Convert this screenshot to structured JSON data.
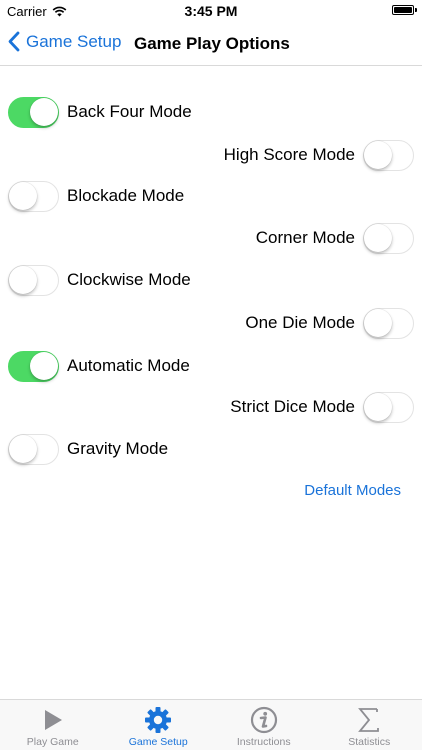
{
  "status": {
    "carrier": "Carrier",
    "time": "3:45 PM"
  },
  "nav": {
    "back_label": "Game Setup",
    "title": "Game Play Options"
  },
  "options": [
    {
      "label": "Back Four Mode",
      "on": true,
      "side": "left"
    },
    {
      "label": "High Score Mode",
      "on": false,
      "side": "right"
    },
    {
      "label": "Blockade Mode",
      "on": false,
      "side": "left"
    },
    {
      "label": "Corner Mode",
      "on": false,
      "side": "right"
    },
    {
      "label": "Clockwise Mode",
      "on": false,
      "side": "left"
    },
    {
      "label": "One Die Mode",
      "on": false,
      "side": "right"
    },
    {
      "label": "Automatic Mode",
      "on": true,
      "side": "left"
    },
    {
      "label": "Strict Dice Mode",
      "on": false,
      "side": "right"
    },
    {
      "label": "Gravity Mode",
      "on": false,
      "side": "left"
    }
  ],
  "default_modes_label": "Default Modes",
  "tabs": [
    {
      "label": "Play Game",
      "icon": "play-icon",
      "active": false
    },
    {
      "label": "Game Setup",
      "icon": "gear-icon",
      "active": true
    },
    {
      "label": "Instructions",
      "icon": "info-icon",
      "active": false
    },
    {
      "label": "Statistics",
      "icon": "sigma-icon",
      "active": false
    }
  ],
  "colors": {
    "accent": "#1a73d9",
    "switch_on": "#4cd964",
    "tab_inactive": "#8e8e93"
  }
}
